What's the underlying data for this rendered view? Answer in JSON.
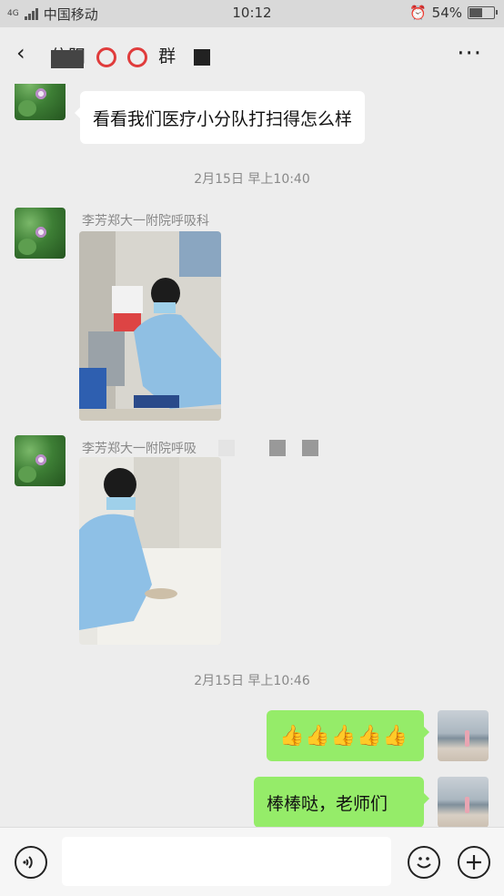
{
  "status_bar": {
    "network_label": "4G",
    "carrier": "中国移动",
    "time": "10:12",
    "battery": "54%",
    "battery_level": 0.54
  },
  "header": {
    "title_prefix": "信阳",
    "title_suffix": "群"
  },
  "messages": [
    {
      "text": "看看我们医疗小分队打扫得怎么样"
    },
    {
      "timestamp": "2月15日 早上10:40"
    },
    {
      "sender": "李芳郑大一附院呼吸科"
    },
    {
      "sender": "李芳郑大一附院呼吸"
    },
    {
      "timestamp": "2月15日 早上10:46"
    },
    {
      "emoji": "👍👍👍👍👍"
    },
    {
      "text": "棒棒哒，老师们"
    }
  ],
  "icons": {
    "back": "back-arrow-icon",
    "more": "more-icon",
    "voice": "voice-icon",
    "emoji": "emoji-icon",
    "plus": "plus-icon"
  },
  "colors": {
    "outgoing_bubble": "#95ec69",
    "incoming_bubble": "#ffffff",
    "background": "#ededed"
  }
}
